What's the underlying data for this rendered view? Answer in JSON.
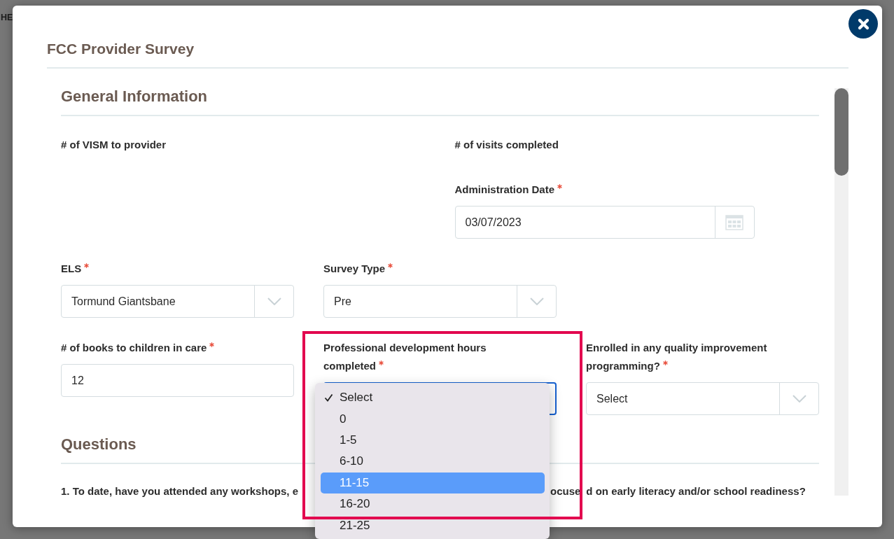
{
  "background": {
    "text": "HE"
  },
  "dialog": {
    "title": "FCC Provider Survey"
  },
  "general_information": {
    "title": "General Information",
    "summary": [
      {
        "label": "# of VISM to provider"
      },
      {
        "label": "# of visits completed"
      }
    ],
    "administration_date": {
      "kind": "date",
      "label": "Administration Date",
      "required": true,
      "focused": false,
      "annotated": false,
      "value": "03/07/2023"
    },
    "rows": [
      {
        "fields": [
          {
            "kind": "select",
            "label": "ELS",
            "required": true,
            "focused": false,
            "expanded": false,
            "annotated": false,
            "value": "Tormund Giantsbane"
          },
          {
            "kind": "select",
            "label": "Survey Type",
            "required": true,
            "focused": false,
            "expanded": false,
            "annotated": false,
            "value": "Pre"
          }
        ]
      },
      {
        "fields": [
          {
            "kind": "text",
            "label": "# of books to children in care",
            "required": true,
            "focused": false,
            "annotated": false,
            "value": "12"
          },
          {
            "kind": "select",
            "label": "Professional development hours completed",
            "required": true,
            "focused": true,
            "expanded": true,
            "annotated": true,
            "options": [
              {
                "label": "Select",
                "selected": true,
                "highlighted": false
              },
              {
                "label": "0",
                "selected": false,
                "highlighted": false
              },
              {
                "label": "1-5",
                "selected": false,
                "highlighted": false
              },
              {
                "label": "6-10",
                "selected": false,
                "highlighted": false
              },
              {
                "label": "11-15",
                "selected": false,
                "highlighted": true
              },
              {
                "label": "16-20",
                "selected": false,
                "highlighted": false
              },
              {
                "label": "21-25",
                "selected": false,
                "highlighted": false
              }
            ]
          },
          {
            "kind": "select",
            "label": "Enrolled in any quality improvement programming?",
            "required": true,
            "focused": false,
            "expanded": false,
            "annotated": false,
            "value": "Select"
          }
        ]
      }
    ]
  },
  "questions": {
    "title": "Questions",
    "items": [
      {
        "text_parts": [
          "1. To date, have you attended any workshops, e",
          "ocuse",
          "d on early literacy and/or school readiness?"
        ]
      }
    ]
  }
}
